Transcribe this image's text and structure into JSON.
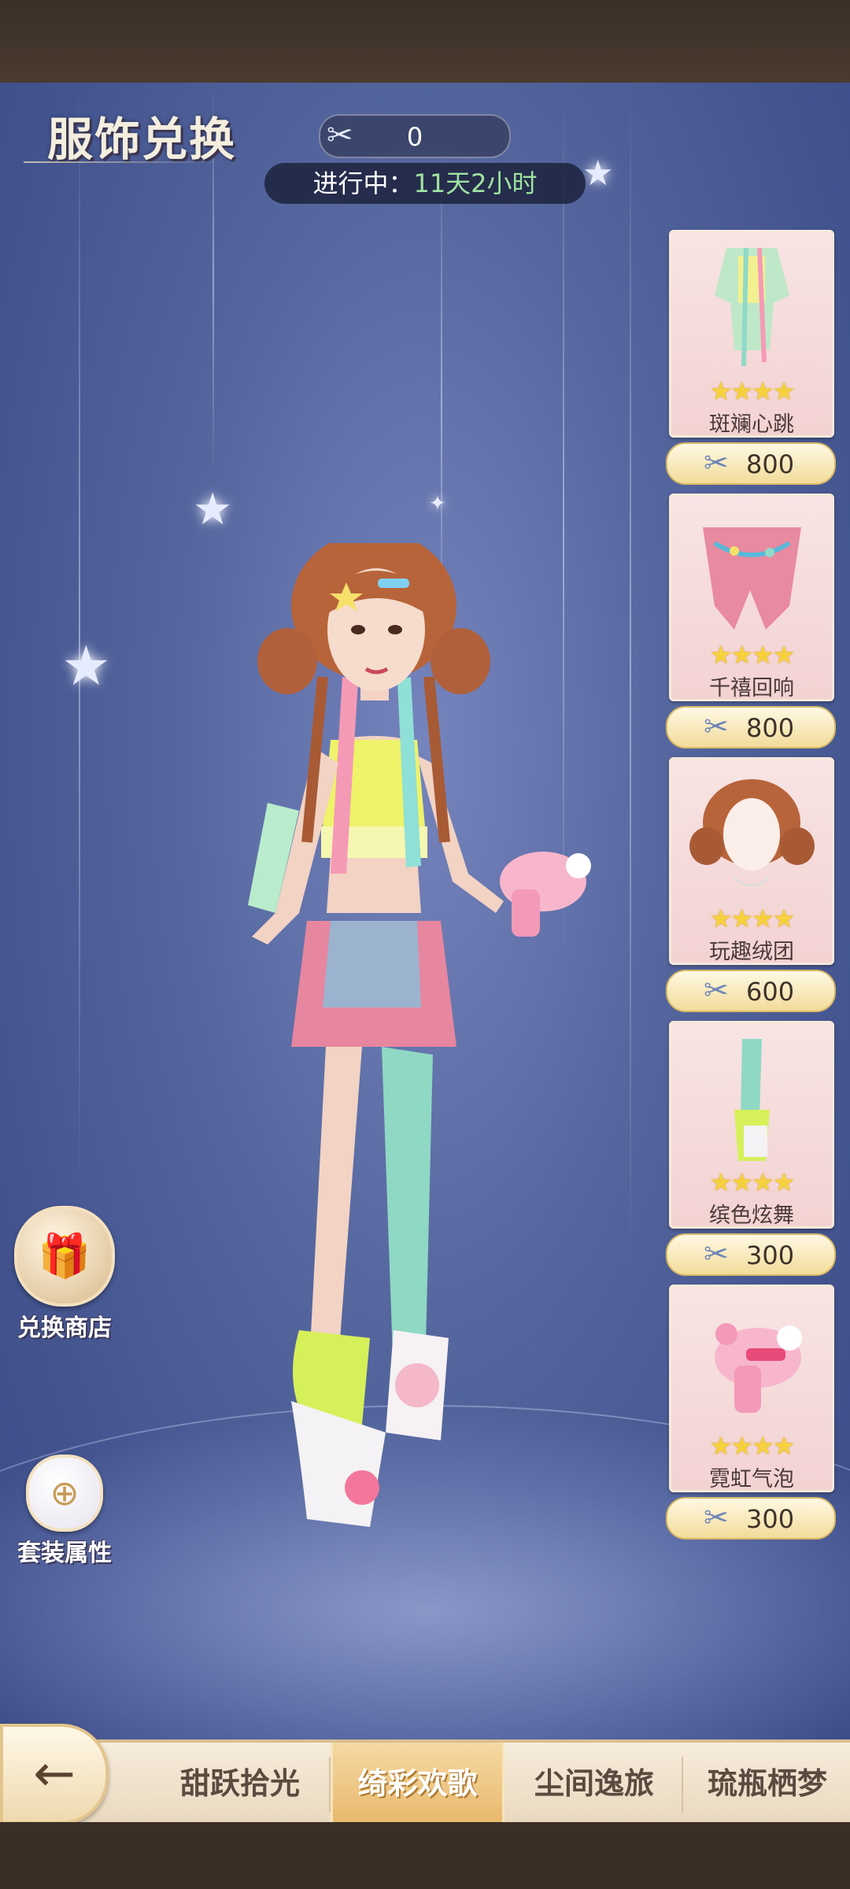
{
  "header": {
    "title": "服饰兑换"
  },
  "currency": {
    "icon": "scissors-icon",
    "amount": "0"
  },
  "event": {
    "status_label": "进行中：",
    "remaining": "11天2小时"
  },
  "items": [
    {
      "name": "斑斓心跳",
      "stars": "★★★★",
      "price": "800",
      "thumb": "top"
    },
    {
      "name": "千禧回响",
      "stars": "★★★★",
      "price": "800",
      "thumb": "jacket"
    },
    {
      "name": "玩趣绒团",
      "stars": "★★★★",
      "price": "600",
      "thumb": "hair"
    },
    {
      "name": "缤色炫舞",
      "stars": "★★★★",
      "price": "300",
      "thumb": "legs"
    },
    {
      "name": "霓虹气泡",
      "stars": "★★★★",
      "price": "300",
      "thumb": "blaster"
    }
  ],
  "left_buttons": {
    "shop_label": "兑换商店",
    "attr_label": "套装属性"
  },
  "tabs": [
    {
      "label": "甜跃拾光",
      "active": false
    },
    {
      "label": "绮彩欢歌",
      "active": true
    },
    {
      "label": "尘间逸旅",
      "active": false
    },
    {
      "label": "琉瓶栖梦",
      "active": false
    }
  ],
  "nav": {
    "back_icon": "back-arrow-icon"
  }
}
